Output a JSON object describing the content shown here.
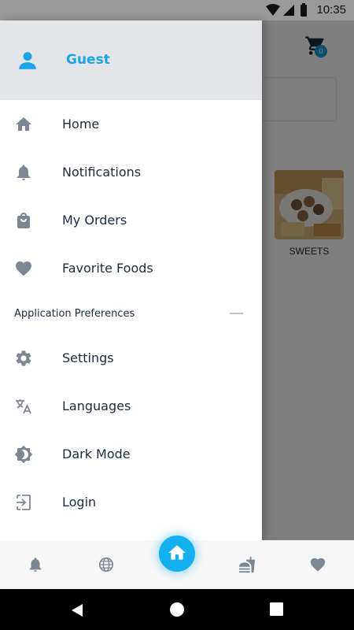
{
  "status_bar": {
    "time": "10:35"
  },
  "cart": {
    "count": "0"
  },
  "category": {
    "label": "SWEETS"
  },
  "drawer": {
    "user_name": "Guest",
    "items": [
      {
        "label": "Home",
        "icon": "home-icon"
      },
      {
        "label": "Notifications",
        "icon": "bell-icon"
      },
      {
        "label": "My Orders",
        "icon": "shopping-bag-icon"
      },
      {
        "label": "Favorite Foods",
        "icon": "heart-icon"
      }
    ],
    "section_title": "Application Preferences",
    "pref_items": [
      {
        "label": "Settings",
        "icon": "gear-icon"
      },
      {
        "label": "Languages",
        "icon": "translate-icon"
      },
      {
        "label": "Dark Mode",
        "icon": "brightness-icon"
      },
      {
        "label": "Login",
        "icon": "login-icon"
      }
    ]
  },
  "bottom_nav": {
    "items": [
      "bell-icon",
      "globe-icon",
      "home-icon",
      "fastfood-icon",
      "heart-icon"
    ]
  },
  "colors": {
    "accent": "#1aa6e4",
    "header_bg": "#e3e5e9",
    "text": "#1b2a3d",
    "icon_grey": "#7d8794"
  }
}
